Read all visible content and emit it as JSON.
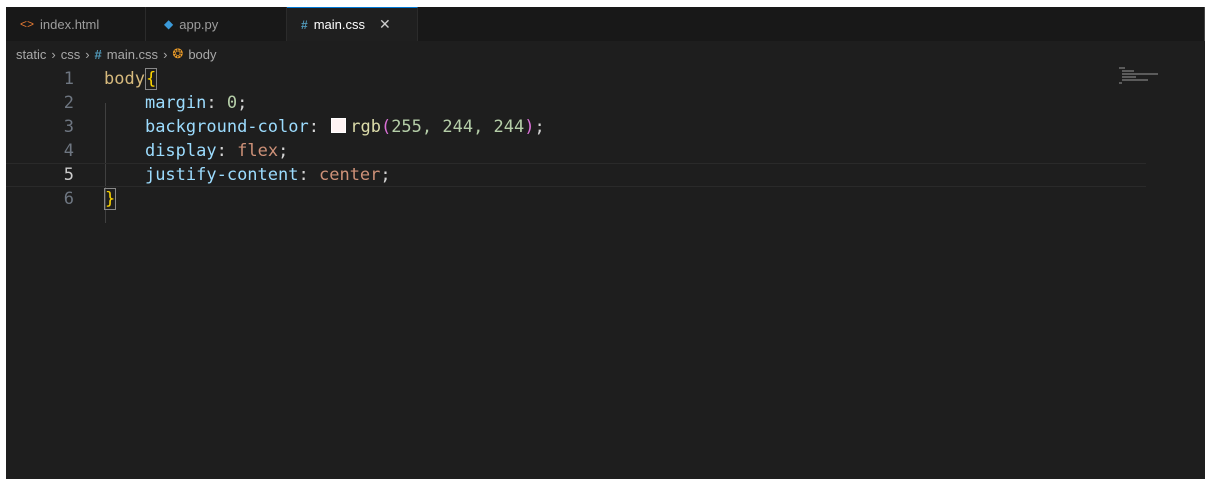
{
  "tabs": [
    {
      "label": "index.html",
      "icon": "html-file-icon",
      "active": false
    },
    {
      "label": "app.py",
      "icon": "python-file-icon",
      "active": false
    },
    {
      "label": "main.css",
      "icon": "css-file-icon",
      "active": true
    }
  ],
  "breadcrumb": {
    "parts": [
      "static",
      "css",
      "main.css",
      "body"
    ]
  },
  "editor": {
    "line_numbers": [
      "1",
      "2",
      "3",
      "4",
      "5",
      "6"
    ],
    "current_line": 5,
    "lines": {
      "l1": {
        "selector": "body",
        "open": "{"
      },
      "l2": {
        "prop": "margin",
        "colon": ":",
        "value": "0",
        "semi": ";"
      },
      "l3": {
        "prop": "background-color",
        "colon": ":",
        "fn": "rgb",
        "lparen": "(",
        "args": "255, 244, 244",
        "rparen": ")",
        "semi": ";"
      },
      "l4": {
        "prop": "display",
        "colon": ":",
        "value": "flex",
        "semi": ";"
      },
      "l5": {
        "prop": "justify-content",
        "colon": ":",
        "value": "center",
        "semi": ";"
      },
      "l6": {
        "close": "}"
      }
    }
  },
  "colors": {
    "swatch": "#fff4f4",
    "editor_bg": "#1e1e1e",
    "active_tab_accent": "#0078d4"
  }
}
